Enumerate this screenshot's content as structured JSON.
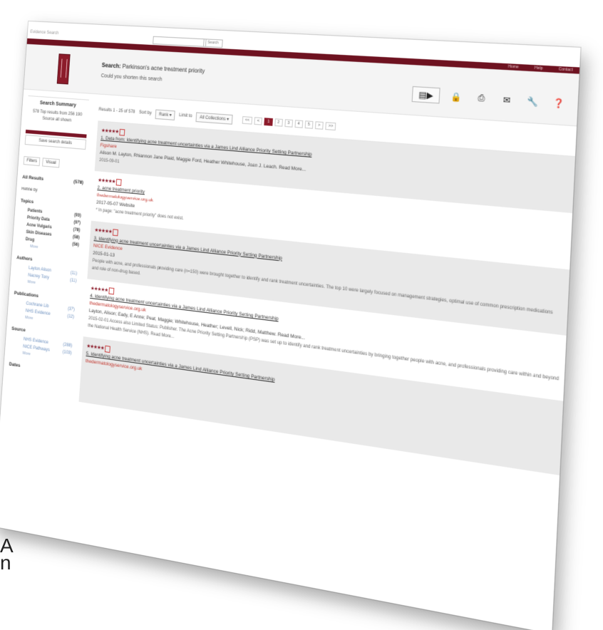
{
  "edge_text": [
    ",",
    "A",
    "n"
  ],
  "topbar": {
    "brand": "Evidence Search",
    "search_placeholder": "",
    "search_button": "Search",
    "menu": "Home Help Contact"
  },
  "header": {
    "title_prefix": "Search:",
    "title_query": "Parkinson's acne treatment priority",
    "subtitle": "Could you shorten this search"
  },
  "tools": [
    "folder-icon",
    "lock-icon",
    "print-icon",
    "email-icon",
    "wrench-icon",
    "help-icon"
  ],
  "sidebar": {
    "summary_heading": "Search Summary",
    "summary_text": "578 Top results from 256 190 Source all shown",
    "save_button": "Save search details",
    "tabs": [
      "Filters",
      "Visual"
    ],
    "all_results_label": "All Results",
    "all_results_count": "(578)",
    "refine_label": "Refine by",
    "facets": [
      {
        "heading": "Topics",
        "rows": [
          {
            "label": "Patients",
            "count": "(93)"
          },
          {
            "label": "Priority Data",
            "count": "(97)"
          },
          {
            "label": "Acne Vulgaris",
            "count": "(78)"
          },
          {
            "label": "Skin Diseases",
            "count": "(58)"
          },
          {
            "label": "Drug",
            "count": "(56)"
          }
        ],
        "more": "More"
      },
      {
        "heading": "Authors",
        "rows": [
          {
            "label": "Layton Alison",
            "count": "(11)"
          },
          {
            "label": "Nacrey Tony",
            "count": "(11)"
          }
        ],
        "more": "More"
      },
      {
        "heading": "Publications",
        "rows": [
          {
            "label": "Cochrane Lib",
            "count": "(37)"
          },
          {
            "label": "NHS Evidence",
            "count": "(12)"
          }
        ],
        "more": "More"
      },
      {
        "heading": "Source",
        "rows": [
          {
            "label": "NHS Evidence",
            "count": "(288)"
          },
          {
            "label": "NICE Pathways",
            "count": "(103)"
          }
        ],
        "more": "More"
      },
      {
        "heading": "Dates",
        "rows": [],
        "more": ""
      }
    ]
  },
  "controls": {
    "results_text": "Results 1 - 25 of 578",
    "sort_label": "Sort by",
    "sort_value": "Rank",
    "limit_label": "Limit to",
    "limit_value": "All Collections",
    "pages": [
      "<<",
      "<",
      "1",
      "2",
      "3",
      "4",
      "5",
      ">",
      ">>"
    ]
  },
  "results": [
    {
      "stars": "★★★★★",
      "title": "1. Data from: Identifying acne treatment uncertainties via a James Lind Alliance Priority Setting Partnership",
      "source": "Figshare",
      "meta": "Alison M. Layton, Rhiannon Jane Plaid, Maggie Ford, Heather Whitehouse, Joan J. Leach. Read More...",
      "foot": "2015-09-01",
      "shade": true
    },
    {
      "stars": "★★★★★",
      "title": "2. acne treatment priority",
      "source": "thedermatologyservice.org.uk",
      "meta": "2017-05-07 Website",
      "foot": "* In page: \"acne treatment priority\" does not exist.",
      "shade": false
    },
    {
      "stars": "★★★★★",
      "title": "3. Identifying acne treatment uncertainties via a James Lind Alliance Priority Setting Partnership",
      "source": "NICE Evidence",
      "meta": "2015-01-13",
      "foot": "People with acne, and professionals providing care (n=150) were brought together to identify and rank treatment uncertainties. The top 10 were largely focused on management strategies, optimal use of common prescription medications and role of non-drug based.",
      "shade": true
    },
    {
      "stars": "★★★★★",
      "title": "4. Identifying acne treatment uncertainties via a James Lind Alliance Priority Setting Partnership",
      "source": "thedermatologyservice.org.uk",
      "meta": "Layton, Alison; Eady, E Anne; Peat, Maggie; Whitehouse, Heather; Levell, Nick; Ridd, Matthew. Read More...",
      "foot": "2015-02-01 Access also Limited Status: Publisher. The Acne Priority Setting Partnership (PSP) was set up to identify and rank treatment uncertainties by bringing together people with acne, and professionals providing care within and beyond the National Health Service (NHS). Read More...",
      "shade": false
    },
    {
      "stars": "★★★★★",
      "title": "5. Identifying acne treatment uncertainties via a James Lind Alliance Priority Setting Partnership",
      "source": "thedermatologyservice.org.uk",
      "meta": "",
      "foot": "",
      "shade": true
    }
  ]
}
